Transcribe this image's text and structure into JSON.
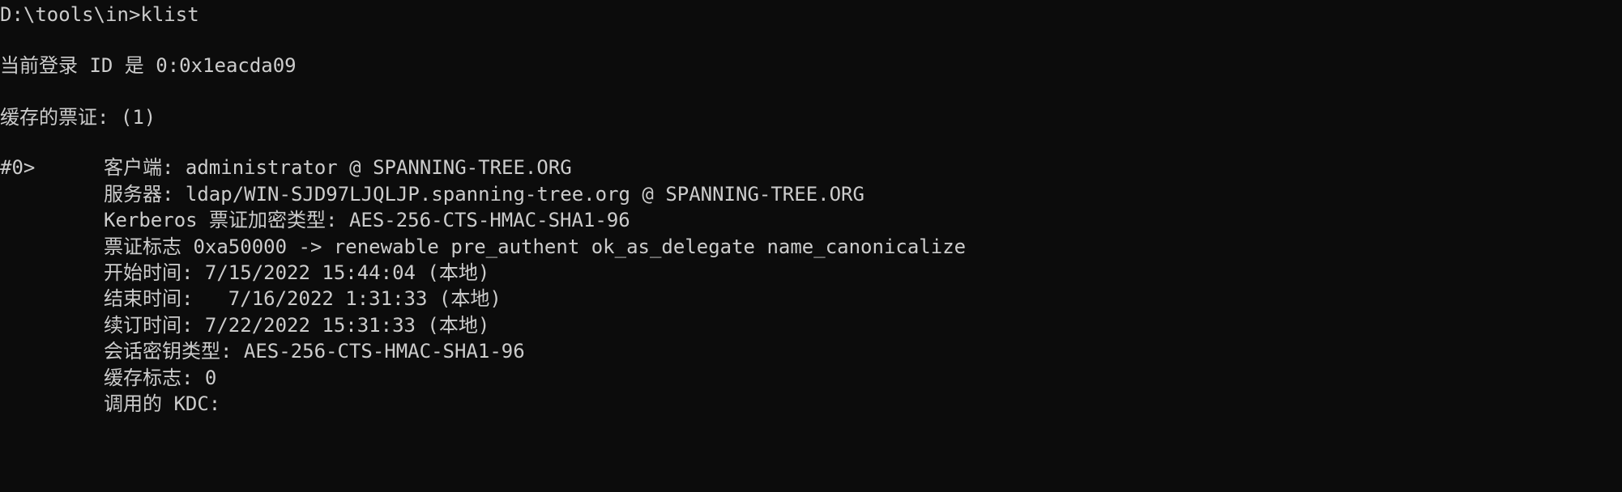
{
  "console": {
    "prompt": "D:\\tools\\in>klist",
    "logon_id": "当前登录 ID 是 0:0x1eacda09",
    "cached_tickets": "缓存的票证: (1)",
    "ticket": {
      "id": "#0>",
      "client": "客户端: administrator @ SPANNING-TREE.ORG",
      "server": "服务器: ldap/WIN-SJD97LJQLJP.spanning-tree.org @ SPANNING-TREE.ORG",
      "encryption_type": "Kerberos 票证加密类型: AES-256-CTS-HMAC-SHA1-96",
      "ticket_flags": "票证标志 0xa50000 -> renewable pre_authent ok_as_delegate name_canonicalize",
      "start_time": "开始时间: 7/15/2022 15:44:04 (本地)",
      "end_time": "结束时间:   7/16/2022 1:31:33 (本地)",
      "renew_time": "续订时间: 7/22/2022 15:31:33 (本地)",
      "session_key_type": "会话密钥类型: AES-256-CTS-HMAC-SHA1-96",
      "cache_flags": "缓存标志: 0",
      "kdc_called": "调用的 KDC:"
    }
  }
}
